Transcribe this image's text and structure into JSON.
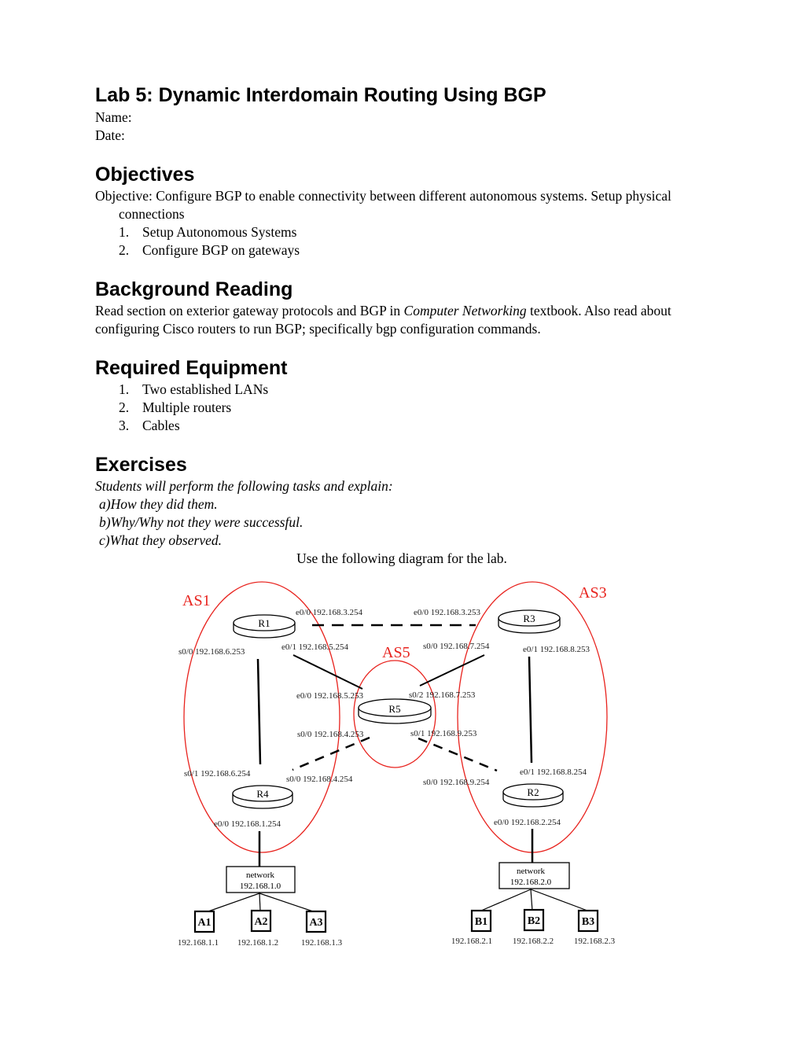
{
  "title": "Lab 5: Dynamic Interdomain Routing Using BGP",
  "name_label": "Name:",
  "date_label": "Date:",
  "objectives": {
    "heading": "Objectives",
    "text": "Objective:  Configure BGP to enable connectivity between different autonomous systems.  Setup physical connections",
    "items": [
      "Setup Autonomous Systems",
      "Configure BGP on gateways"
    ]
  },
  "background": {
    "heading": "Background Reading",
    "text_pre": "Read section on exterior gateway protocols and BGP in ",
    "text_book": "Computer Networking",
    "text_post": " textbook. Also read about configuring Cisco routers to run BGP; specifically bgp configuration commands."
  },
  "equipment": {
    "heading": "Required Equipment",
    "items": [
      "Two established LANs",
      "Multiple routers",
      "Cables"
    ]
  },
  "exercises": {
    "heading": "Exercises",
    "intro": "Students will perform the following tasks and explain:",
    "sub": [
      "a)How they did them.",
      "b)Why/Why not they were successful.",
      "c)What they observed."
    ],
    "diagram_caption": "Use the following diagram for the lab."
  },
  "diagram": {
    "as_labels": {
      "as1": "AS1",
      "as3": "AS3",
      "as5": "AS5"
    },
    "as_color": "#e8231e",
    "routers": {
      "r1": "R1",
      "r2": "R2",
      "r3": "R3",
      "r4": "R4",
      "r5": "R5"
    },
    "interfaces": {
      "r1_e00": "e0/0 192.168.3.254",
      "r1_e01": "e0/1 192.168.5.254",
      "r1_s00": "s0/0 192.168.6.253",
      "r3_e00": "e0/0 192.168.3.253",
      "r3_s00": "s0/0 192.168.7.254",
      "r3_e01": "e0/1 192.168.8.253",
      "r5_e00": "e0/0 192.168.5.253",
      "r5_s02": "s0/2 192.168.7.253",
      "r5_s00": "s0/0 192.168.4.253",
      "r5_s01": "s0/1 192.168.9.253",
      "r4_s01": "s0/1 192.168.6.254",
      "r4_s00": "s0/0 192.168.4.254",
      "r4_e00": "e0/0 192.168.1.254",
      "r2_e01": "e0/1 192.168.8.254",
      "r2_s00": "s0/0 192.168.9.254",
      "r2_e00": "e0/0 192.168.2.254"
    },
    "networks": {
      "left_label": "network",
      "left_addr": "192.168.1.0",
      "right_label": "network",
      "right_addr": "192.168.2.0"
    },
    "hosts": {
      "a1": "A1",
      "a2": "A2",
      "a3": "A3",
      "b1": "B1",
      "b2": "B2",
      "b3": "B3",
      "a1_ip": "192.168.1.1",
      "a2_ip": "192.168.1.2",
      "a3_ip": "192.168.1.3",
      "b1_ip": "192.168.2.1",
      "b2_ip": "192.168.2.2",
      "b3_ip": "192.168.2.3"
    }
  }
}
